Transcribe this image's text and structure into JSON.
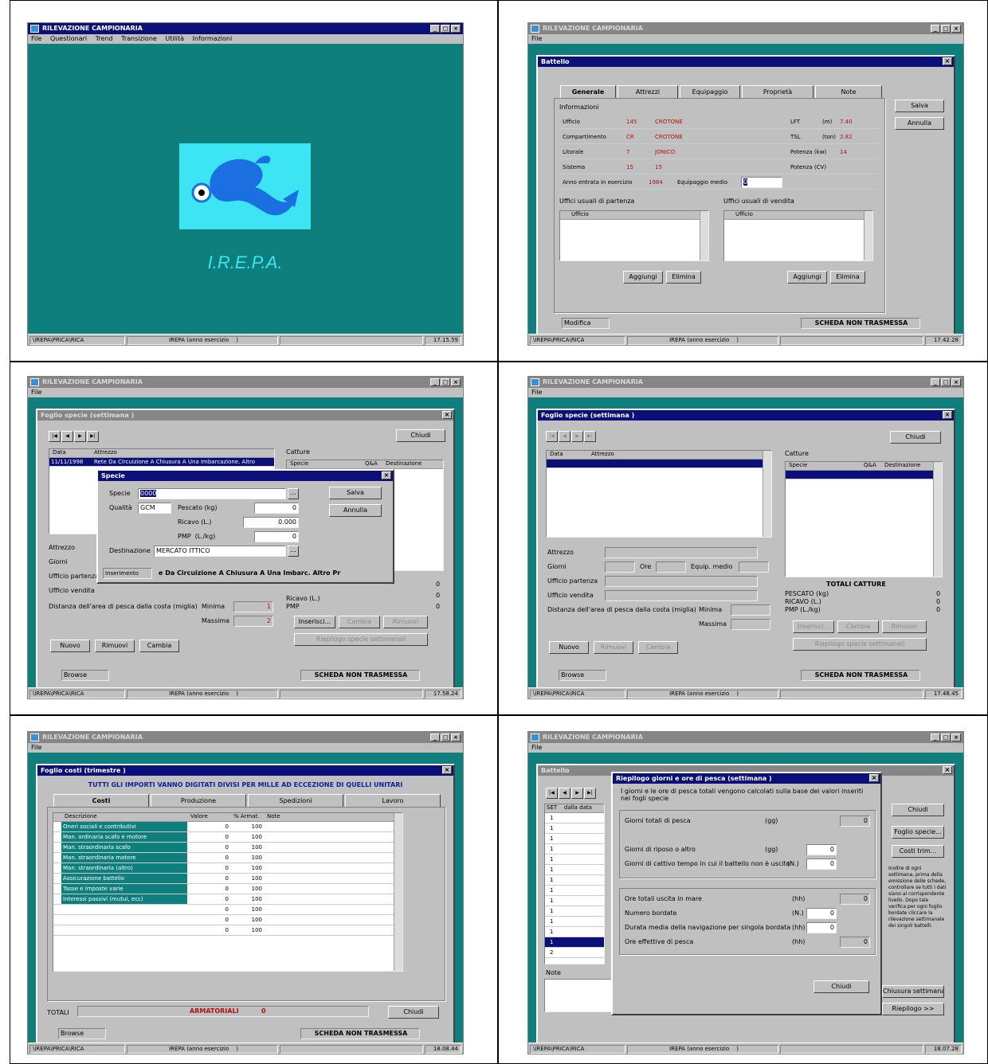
{
  "app_title": "RILEVAZIONE CAMPIONARIA",
  "menus": [
    "File",
    "Questionari",
    "Trend",
    "Transizione",
    "Utilità",
    "Informazioni"
  ],
  "menu_file": "File",
  "status": {
    "path": "\\IREPA\\PRICA\\RICA",
    "mode": "IREPA (anno esercizio",
    "sep": ")"
  },
  "times": [
    "17.15.59",
    "17.42.28",
    "17.58.24",
    "17.48.45",
    "18.08.44",
    "18.07.28"
  ],
  "logo": {
    "text": "I.R.E.P.A."
  },
  "battello": {
    "title": "Battello",
    "tabs": [
      "Generale",
      "Attrezzi",
      "Equipaggio",
      "Proprietà",
      "Note"
    ],
    "group": "Informazioni",
    "rows": [
      {
        "l": "Ufficio",
        "c": "145",
        "v": "CROTONE",
        "r": "LFT",
        "u": "(m)",
        "n": "7.40"
      },
      {
        "l": "Compartimento",
        "c": "CR",
        "v": "CROTONE",
        "r": "TSL",
        "u": "(ton)",
        "n": "2.82"
      },
      {
        "l": "Litorale",
        "c": "7",
        "v": "JONICO",
        "r": "Potenza (kw)",
        "u": "",
        "n": "14"
      },
      {
        "l": "Sistema",
        "c": "15",
        "v": "15",
        "r": "Potenza (CV)",
        "u": "",
        "n": ""
      }
    ],
    "year_label": "Anno entrata in esercizio",
    "year": "1984",
    "crew_label": "Equipaggio medio",
    "crew": "0",
    "partenza": "Uffici usuali di partenza",
    "vendita": "Uffici usuali di vendita",
    "col": "Ufficio",
    "add": "Aggiungi",
    "del": "Elimina",
    "save": "Salva",
    "cancel": "Annulla",
    "state": "Modifica",
    "scheda": "SCHEDA NON TRASMESSA"
  },
  "foglio_specie": {
    "title": "Foglio specie (settimana  )",
    "close": "Chiudi",
    "cols": [
      "Data",
      "Attrezzo"
    ],
    "row_date": "11/11/1998",
    "row_gear": "Rete Da Circuizione A Chiusura A Una Imbarcazione. Altro",
    "catture": "Catture",
    "cat_cols": [
      "Specie",
      "Q&A",
      "Destinazione"
    ],
    "fields": [
      "Attrezzo",
      "Giorni",
      "Ufficio partenza",
      "Ufficio vendita"
    ],
    "ore": "Ore",
    "equip": "Equip. medio",
    "distanza": "Distanza dell'area di pesca dalla costa (miglia)",
    "minima": "Minima",
    "massima": "Massima",
    "min_val": "1",
    "max_val": "2",
    "totali": "TOTALI CATTURE",
    "tot_labels": [
      "PESCATO (kg)",
      "RICAVO (L.)",
      "PMP (L./kg)"
    ],
    "tot_zero": "0",
    "buttons": [
      "Nuovo",
      "Rimuovi",
      "Cambia"
    ],
    "cbuttons": [
      "Inserisci...",
      "Cambia",
      "Rimuovi"
    ],
    "riepilogo": "Riepilogo specie settimanali",
    "state": "Browse",
    "scheda": "SCHEDA NON TRASMESSA"
  },
  "specie_dlg": {
    "title": "Specie",
    "specie_label": "Specie",
    "specie_val": "0000",
    "qual_label": "Qualità",
    "qual_val": "GCM",
    "pescato": "Pescato (kg)",
    "pescato_v": "0",
    "ricavo": "Ricavo (L.)",
    "ricavo_v": "0.000",
    "pmp": "PMP",
    "pmp_u": "(L./kg)",
    "pmp_v": "0",
    "dest_label": "Destinazione",
    "dest_val": "MERCATO ITTICO",
    "save": "Salva",
    "cancel": "Annulla",
    "footer_state": "Inserimento",
    "footer_text": "e Da Circuizione A Chiusura A Una Imbarc. Altro Pr"
  },
  "foglio_costi": {
    "title": "Foglio costi (trimestre  )",
    "banner": "TUTTI GLI IMPORTI VANNO DIGITATI DIVISI PER MILLE AD ECCEZIONE DI QUELLI UNITARI",
    "tabs": [
      "Costi",
      "Produzione",
      "Spedizioni",
      "Lavoro"
    ],
    "cols": [
      "Descrizione",
      "Valore",
      "% Armat.",
      "Note"
    ],
    "rows": [
      "Oneri sociali e contributivi",
      "Man. ordinaria scafo e motore",
      "Man. straordinaria scafo",
      "Man. straordinaria motore",
      "Man. straordinaria (altro)",
      "Assicurazione battello",
      "Tasse e imposte varie",
      "Interessi passivi (mutui, ecc)",
      "",
      "",
      ""
    ],
    "val": "0",
    "pct": "100",
    "totali": "TOTALI",
    "armatoriali": "ARMATORIALI",
    "arm_val": "0",
    "close": "Chiudi",
    "state": "Browse",
    "scheda": "SCHEDA NON TRASMESSA"
  },
  "riepilogo": {
    "bg_title": "Battello",
    "title": "Riepilogo giorni e ore di pesca (settimana  )",
    "note": "I giorni e le ore di pesca totali vengono calcolati sulla base dei valori inseriti nei fogli specie",
    "lines": [
      {
        "l": "Giorni totali di pesca",
        "u": "(gg)",
        "v": "0"
      },
      {
        "l": "Giorni di riposo o altro",
        "u": "(gg)",
        "v": "0"
      },
      {
        "l": "Giorni di cattivo tempo in cui il battello non è uscito",
        "u": "(N.)",
        "v": "0"
      },
      {
        "l": "Ore totali uscita in mare",
        "u": "(hh)",
        "v": "0"
      },
      {
        "l": "Numero bordate",
        "u": "(N.)",
        "v": "0"
      },
      {
        "l": "Durata media della navigazione per singola bordata",
        "u": "(hh)",
        "v": "0"
      },
      {
        "l": "Ore effettive di pesca",
        "u": "(hh)",
        "v": "0"
      }
    ],
    "close": "Chiudi",
    "left_cols": [
      "SET",
      "dalla data"
    ],
    "left_vals": [
      "1",
      "1",
      "1",
      "1",
      "1",
      "1",
      "1",
      "1",
      "1",
      "1",
      "1",
      "1",
      "1",
      "2"
    ],
    "nota_label": "Note",
    "side_buttons": [
      "Chiudi",
      "Foglio specie...",
      "Costi trim..."
    ],
    "side_text": "Inoltre di ogni settimana, prima della emissione delle schede, controllare se tutti i dati siano al corrispondente livello. Dopo tale verifica per ogni foglio bordate cliccare la rilevazione settimanale dei singoli battelli.",
    "bottom_buttons": [
      "Chiusura settimana",
      "Riepilogo >>"
    ]
  }
}
